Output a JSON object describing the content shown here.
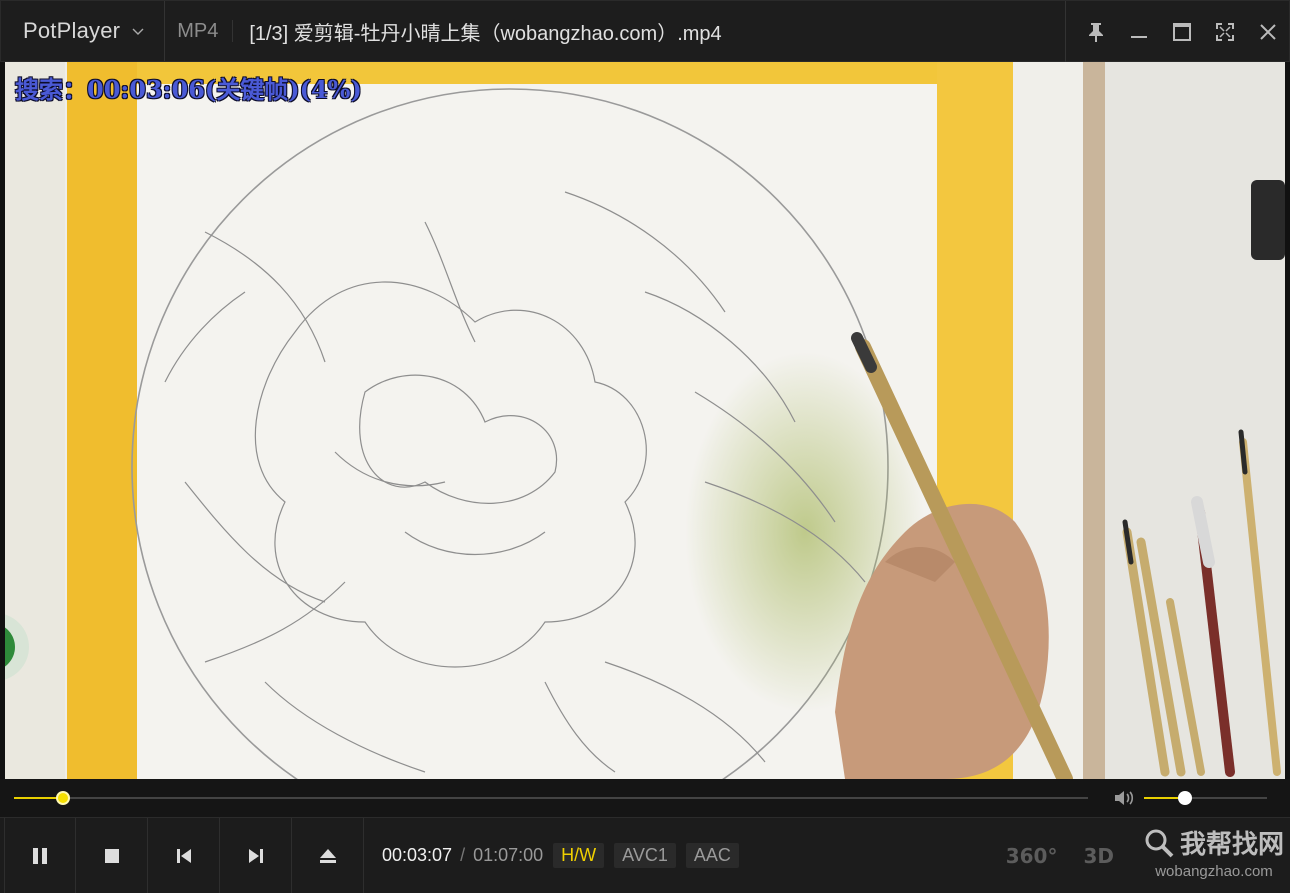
{
  "app": {
    "name": "PotPlayer",
    "format": "MP4",
    "title": "[1/3] 爱剪辑-牡丹小晴上集（wobangzhao.com）.mp4"
  },
  "osd": {
    "text": "搜索：00:03:06(关键帧)(4%)"
  },
  "playback": {
    "current": "00:03:07",
    "separator": "/",
    "duration": "01:07:00",
    "progress_fraction": 0.046,
    "volume_fraction": 0.33
  },
  "tags": {
    "hw": "H/W",
    "video_codec": "AVC1",
    "audio_codec": "AAC"
  },
  "tools": {
    "vr": "360°",
    "threed": "3D"
  },
  "watermark": {
    "main": "我帮找网",
    "sub": "wobangzhao.com"
  },
  "colors": {
    "accent": "#f0d000",
    "osd": "#4a5ad6"
  }
}
